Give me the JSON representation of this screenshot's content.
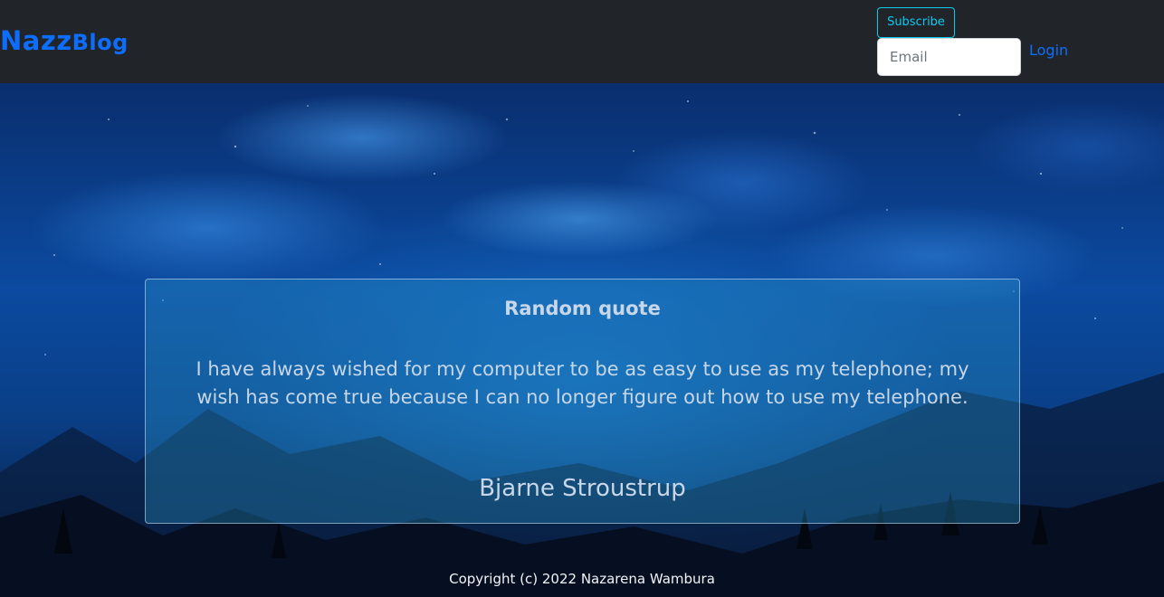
{
  "header": {
    "brand_main": "Nazz",
    "brand_sub": "Blog",
    "subscribe_label": "Subscribe",
    "email_placeholder": "Email",
    "login_label": "Login"
  },
  "quote": {
    "title": "Random quote",
    "text": "I have always wished for my computer to be as easy to use as my telephone; my wish has come true because I can no longer figure out how to use my telephone.",
    "author": "Bjarne Stroustrup"
  },
  "footer": {
    "copyright": "Copyright (c) 2022 Nazarena Wambura"
  },
  "colors": {
    "navbar_bg": "#212529",
    "brand": "#0d6efd",
    "subscribe_outline": "#0dcaf0",
    "quote_text": "#c7d6e8"
  }
}
